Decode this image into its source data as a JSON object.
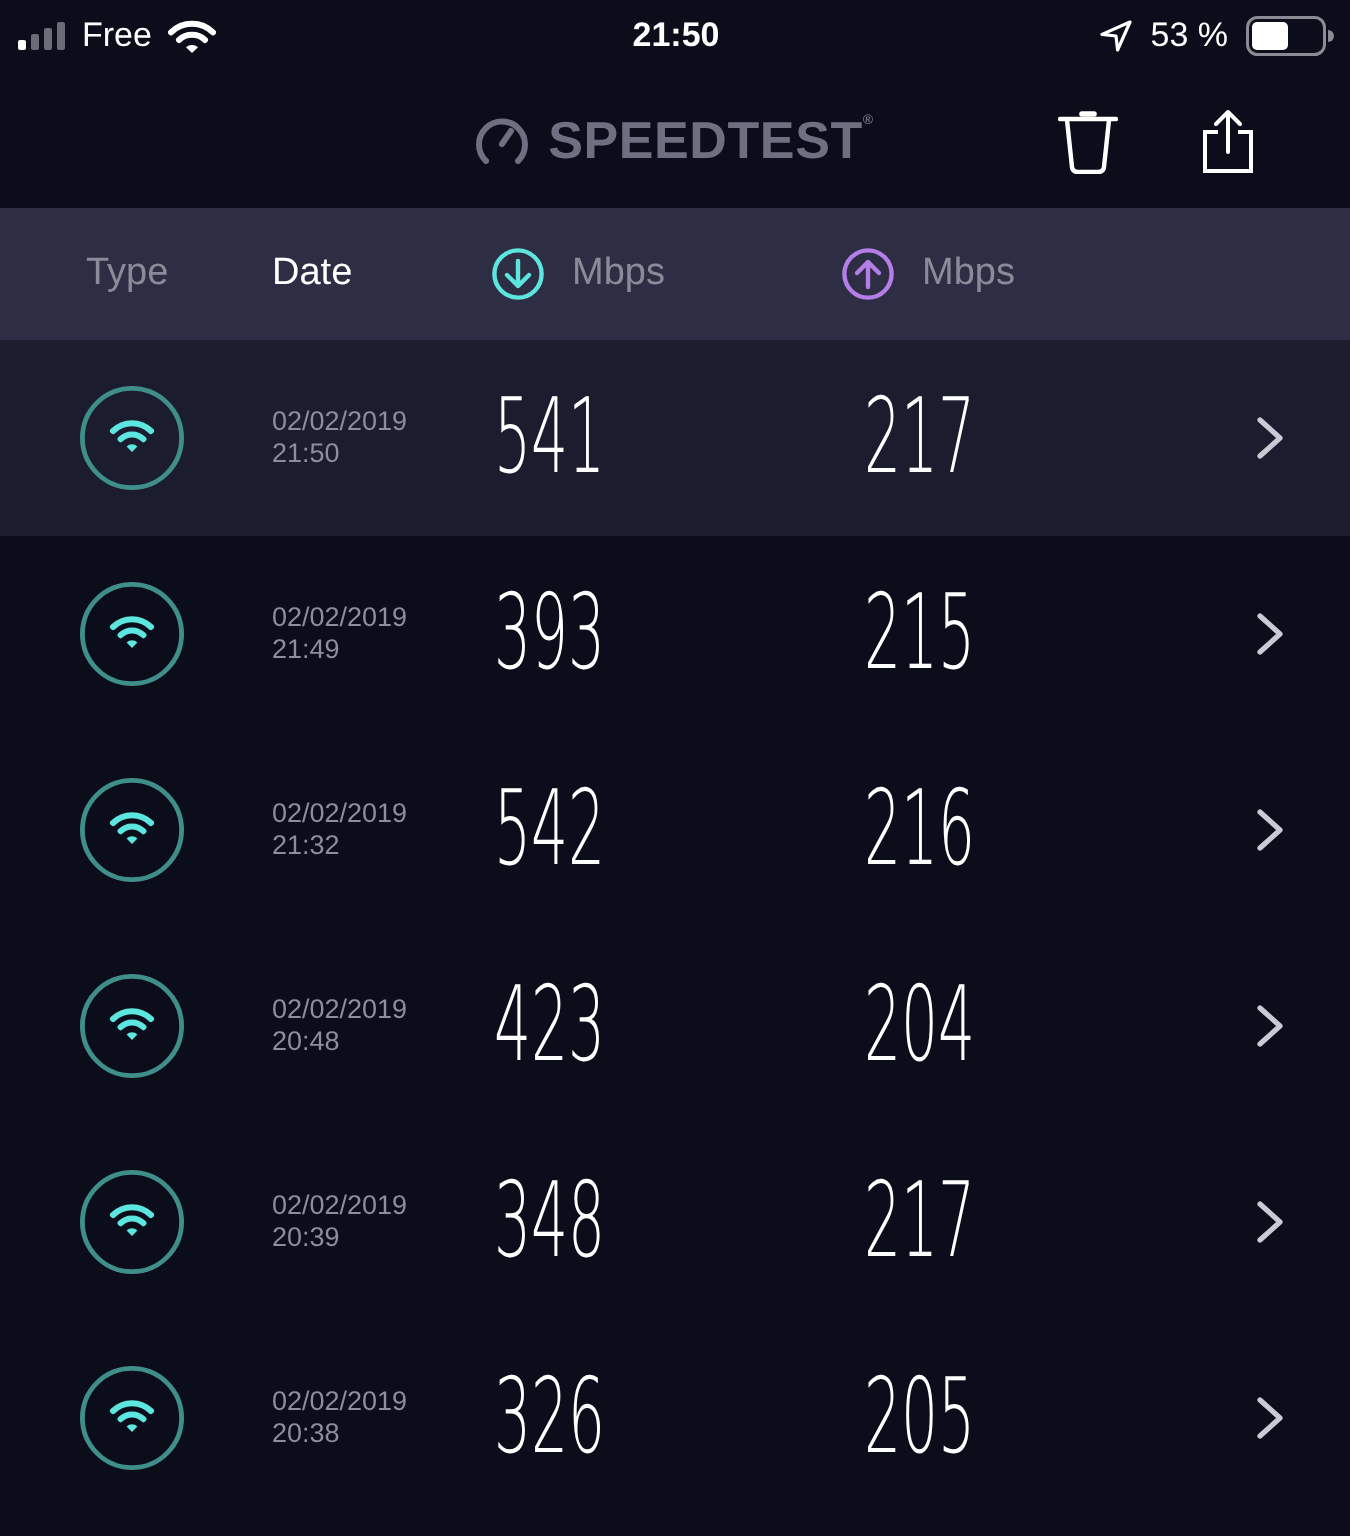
{
  "status_bar": {
    "carrier": "Free",
    "time": "21:50",
    "battery": "53 %"
  },
  "header": {
    "logo": "SPEEDTEST$^{®}$"
  },
  "columns": [
    {
      "kind": "type",
      "label": "Type",
      "selected": false
    },
    {
      "kind": "date",
      "label": "Date",
      "selected": true
    },
    {
      "kind": "download",
      "label": "Mbps",
      "selected": false
    },
    {
      "kind": "upload",
      "label": "Mbps",
      "selected": false
    }
  ],
  "results": [
    {
      "kind": "wifi",
      "selected": true,
      "date": "02/02/2019",
      "time": "21:50",
      "download": "541",
      "upload": "217"
    },
    {
      "kind": "wifi",
      "selected": false,
      "date": "02/02/2019",
      "time": "21:49",
      "download": "393",
      "upload": "215"
    },
    {
      "kind": "wifi",
      "selected": false,
      "date": "02/02/2019",
      "time": "21:32",
      "download": "542",
      "upload": "216"
    },
    {
      "kind": "wifi",
      "selected": false,
      "date": "02/02/2019",
      "time": "20:48",
      "download": "423",
      "upload": "204"
    },
    {
      "kind": "wifi",
      "selected": false,
      "date": "02/02/2019",
      "time": "20:39",
      "download": "348",
      "upload": "217"
    },
    {
      "kind": "wifi",
      "selected": false,
      "date": "02/02/2019",
      "time": "20:38",
      "download": "326",
      "upload": "205"
    }
  ]
}
